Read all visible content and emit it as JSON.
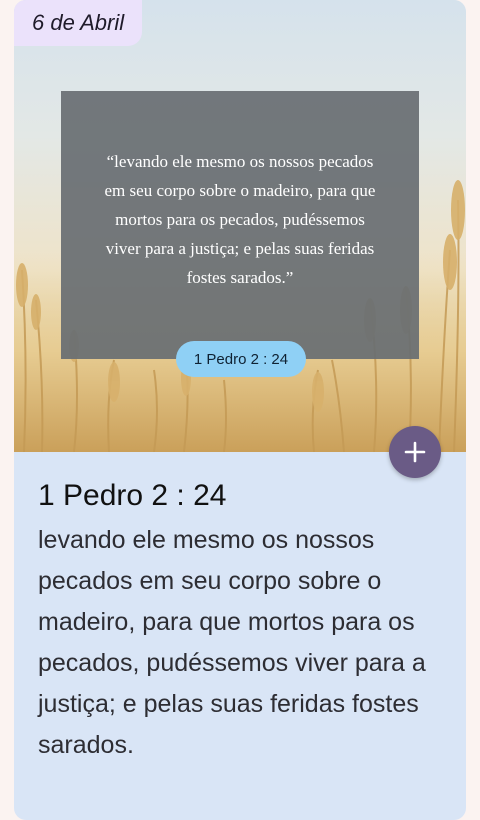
{
  "date": "6 de Abril",
  "verse": {
    "quote": "“levando ele mesmo os nossos pecados em seu corpo sobre o madeiro, para que mortos para os pecados, pudéssemos viver para a justiça; e pelas suas feridas fostes sarados.”",
    "reference": "1 Pedro 2 : 24"
  },
  "detail": {
    "reference": "1 Pedro 2 : 24",
    "text": "levando ele mesmo os nossos pecados em seu corpo sobre o madeiro, para que mortos para os pecados, pudéssemos viver para a justiça; e pelas suas feridas fostes sarados."
  },
  "icons": {
    "fab": "plus-icon"
  },
  "colors": {
    "card_background": "#d9e5f6",
    "date_chip": "#ebe2fb",
    "reference_pill": "#8fd0f5",
    "fab": "#6a5b86",
    "verse_overlay": "#686e72"
  }
}
